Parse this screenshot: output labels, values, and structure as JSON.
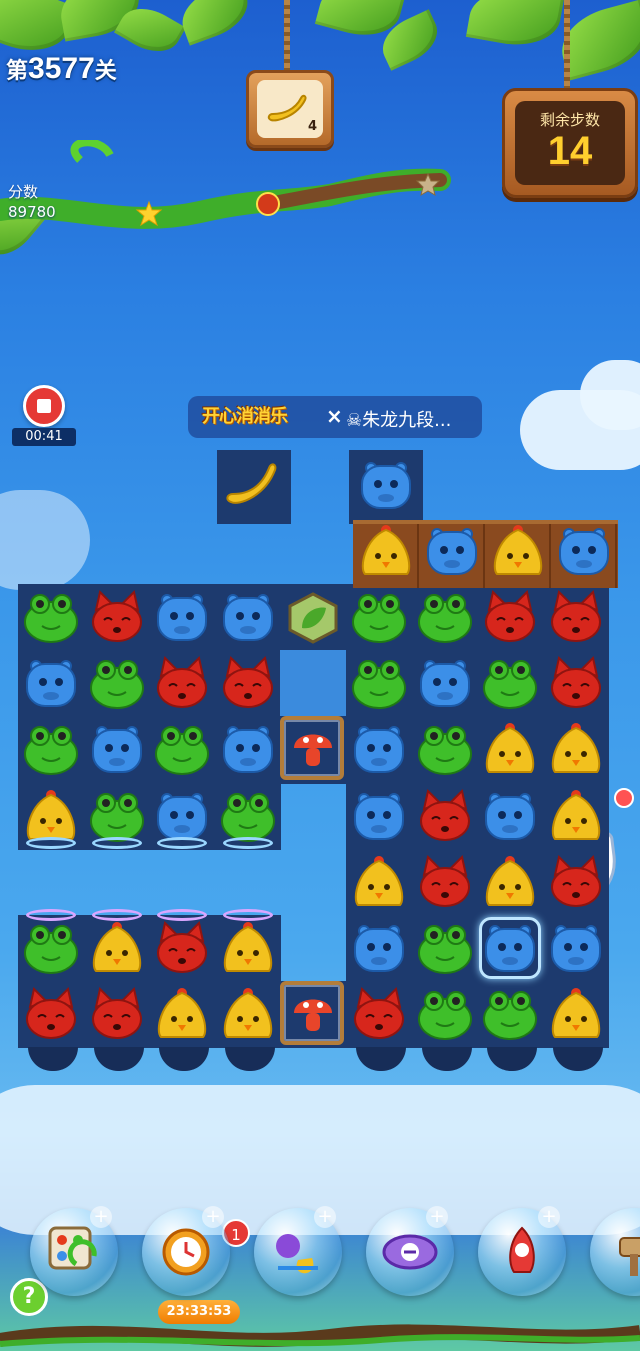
{
  "hud": {
    "level_prefix": "第",
    "level_number": "3577",
    "level_suffix": "关",
    "score_label": "分数",
    "score_value": "89780",
    "score_progress": 0.56,
    "target_item": "pea-pod-icon",
    "target_count": "4",
    "moves_label": "剩余步数",
    "moves_value": "14"
  },
  "recorder": {
    "timer": "00:41"
  },
  "pk_banner": {
    "logo": "开心消消乐",
    "separator": "×",
    "opponent": "☠朱龙九段..."
  },
  "board": {
    "colors": {
      "frog": "#3fbf2a",
      "fox": "#d7261c",
      "hippo": "#3c8fe8",
      "chick": "#f2c11e"
    },
    "top_spawners": [
      "pea-pod",
      "hippo"
    ],
    "wood_row": [
      "chick",
      "hippo",
      "chick",
      "hippo"
    ],
    "rows": [
      [
        "frog",
        "fox",
        "hippo",
        "hippo",
        "leaf",
        "frog",
        "frog",
        "fox",
        "fox"
      ],
      [
        "hippo",
        "frog",
        "fox",
        "fox",
        "empty",
        "frog",
        "hippo",
        "frog",
        "fox"
      ],
      [
        "frog",
        "hippo",
        "frog",
        "hippo",
        "mushroom",
        "hippo",
        "frog",
        "chick",
        "chick"
      ],
      [
        "chick",
        "frog",
        "hippo",
        "frog",
        "void",
        "hippo",
        "fox",
        "hippo",
        "chick"
      ],
      [
        "void",
        "void",
        "void",
        "void",
        "void",
        "chick",
        "fox",
        "chick",
        "fox"
      ],
      [
        "frog",
        "chick",
        "fox",
        "chick",
        "void",
        "hippo",
        "frog",
        "hippo",
        "hippo"
      ],
      [
        "fox",
        "fox",
        "chick",
        "chick",
        "mushroom",
        "fox",
        "frog",
        "frog",
        "chick"
      ]
    ]
  },
  "boosters": [
    {
      "name": "shuffle-booster-icon"
    },
    {
      "name": "clock-booster-icon",
      "badge": "1",
      "timer": "23:33:53"
    },
    {
      "name": "swap-booster-icon"
    },
    {
      "name": "rocket-horizontal-booster-icon"
    },
    {
      "name": "rocket-vertical-booster-icon"
    },
    {
      "name": "hammer-booster-icon"
    }
  ],
  "help_label": "?"
}
